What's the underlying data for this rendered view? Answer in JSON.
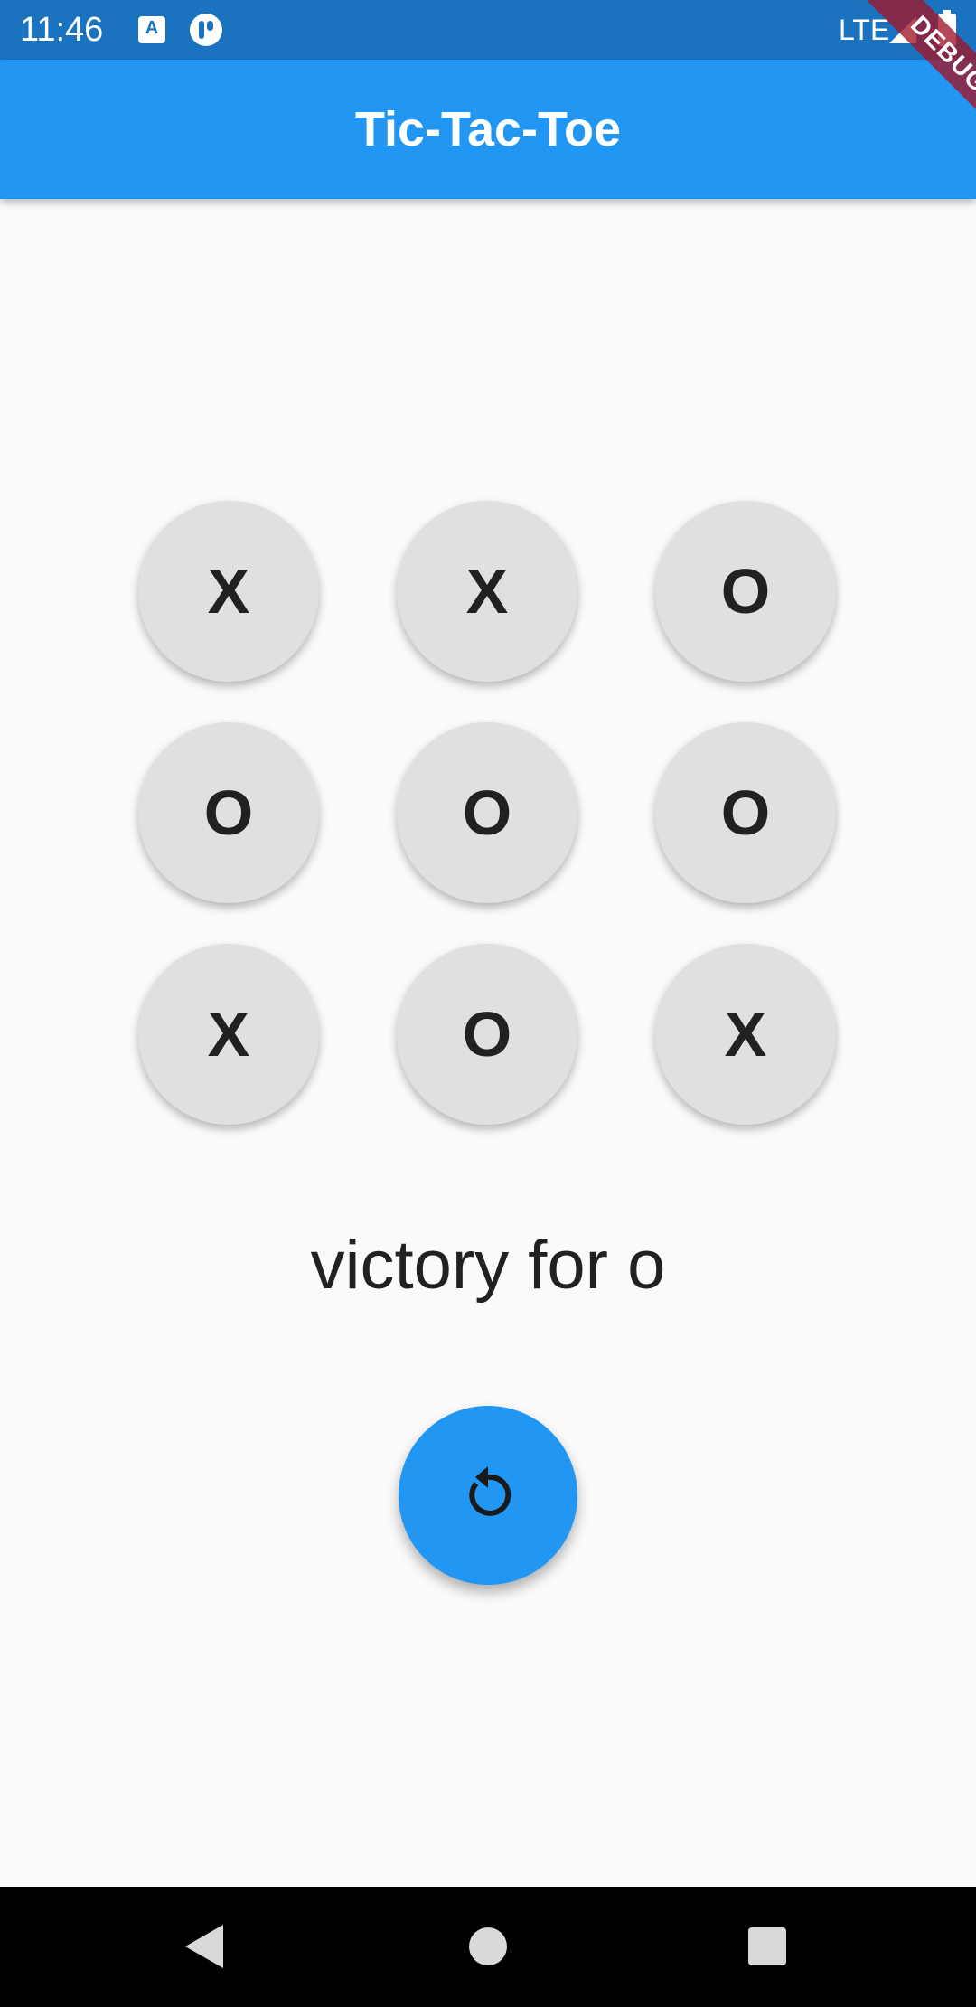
{
  "status_bar": {
    "time": "11:46",
    "network": "LTE",
    "icons": [
      "text-icon",
      "app-icon",
      "signal-icon",
      "battery-icon"
    ],
    "background": "#1b73c0"
  },
  "app_bar": {
    "title": "Tic-Tac-Toe",
    "background": "#2196f3",
    "debug_label": "DEBUG"
  },
  "board": {
    "cells": [
      "X",
      "X",
      "O",
      "O",
      "O",
      "O",
      "X",
      "O",
      "X"
    ]
  },
  "game": {
    "status_message": "victory for o"
  },
  "reset_button": {
    "icon": "restart-icon",
    "color": "#2196f3"
  },
  "nav_bar": {
    "icons": [
      "back-icon",
      "home-icon",
      "recents-icon"
    ]
  }
}
